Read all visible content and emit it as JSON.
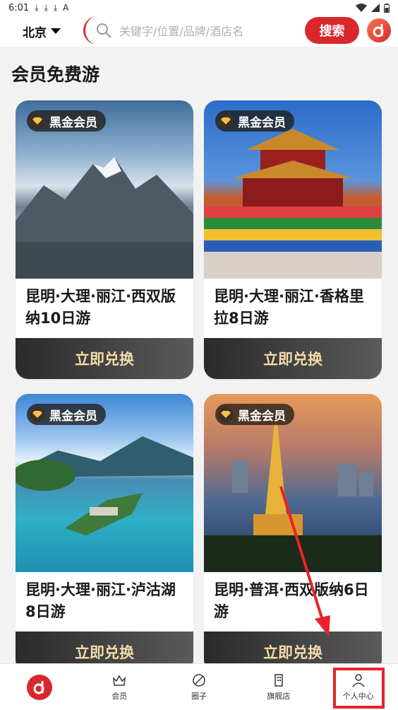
{
  "status_bar": {
    "time": "6:01",
    "notification_icons": [
      "⤓",
      "⤓",
      "⤓",
      "A"
    ]
  },
  "header": {
    "city": "北京",
    "search_placeholder": "关键字/位置/品牌/酒店名",
    "search_button": "搜索"
  },
  "section": {
    "title": "会员免费游"
  },
  "cards": [
    {
      "badge": "黑金会员",
      "title": "昆明·大理·丽江·西双版纳10日游",
      "button": "立即兑换"
    },
    {
      "badge": "黑金会员",
      "title": "昆明·大理·丽江·香格里拉8日游",
      "button": "立即兑换"
    },
    {
      "badge": "黑金会员",
      "title": "昆明·大理·丽江·泸沽湖8日游",
      "button": "立即兑换"
    },
    {
      "badge": "黑金会员",
      "title": "昆明·普洱·西双版纳6日游",
      "button": "立即兑换"
    }
  ],
  "bottom_nav": [
    {
      "label": "",
      "icon": "home-logo-icon"
    },
    {
      "label": "会员",
      "icon": "crown-icon"
    },
    {
      "label": "圈子",
      "icon": "compass-icon"
    },
    {
      "label": "旗舰店",
      "icon": "building-icon"
    },
    {
      "label": "个人中心",
      "icon": "person-icon"
    }
  ],
  "colors": {
    "brand_red": "#d8282c",
    "redeem_text": "#f3d9a6",
    "annotation": "#e8232a"
  }
}
